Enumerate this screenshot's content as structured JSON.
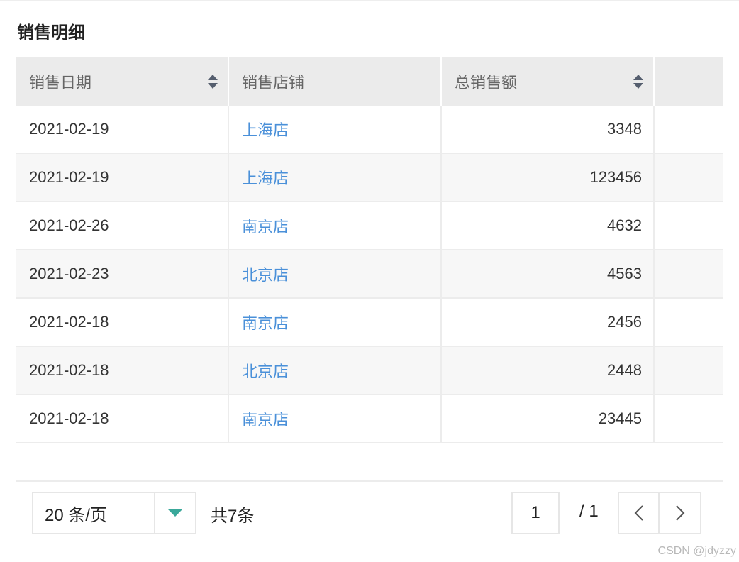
{
  "title": "销售明细",
  "table": {
    "columns": [
      {
        "label": "销售日期",
        "sortable": true
      },
      {
        "label": "销售店铺",
        "sortable": false
      },
      {
        "label": "总销售额",
        "sortable": true
      },
      {
        "label": "",
        "sortable": false
      }
    ],
    "rows": [
      {
        "date": "2021-02-19",
        "store": "上海店",
        "amount": "3348"
      },
      {
        "date": "2021-02-19",
        "store": "上海店",
        "amount": "123456"
      },
      {
        "date": "2021-02-26",
        "store": "南京店",
        "amount": "4632"
      },
      {
        "date": "2021-02-23",
        "store": "北京店",
        "amount": "4563"
      },
      {
        "date": "2021-02-18",
        "store": "南京店",
        "amount": "2456"
      },
      {
        "date": "2021-02-18",
        "store": "北京店",
        "amount": "2448"
      },
      {
        "date": "2021-02-18",
        "store": "南京店",
        "amount": "23445"
      }
    ]
  },
  "pagination": {
    "page_size": "20 条/页",
    "total": "共7条",
    "current_page": "1",
    "total_pages": "/ 1"
  },
  "watermark": "CSDN @jdyzzy",
  "colors": {
    "link": "#4a90d9",
    "header_bg": "#ebebeb",
    "stripe_bg": "#f7f7f7",
    "dropdown_accent": "#3aa89a"
  },
  "icons": [
    "sort-icon",
    "chevron-down-icon",
    "chevron-left-icon",
    "chevron-right-icon"
  ]
}
